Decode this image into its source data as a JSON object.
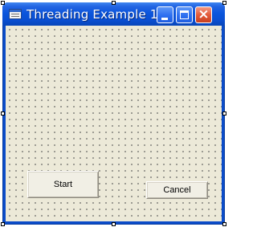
{
  "window": {
    "title": "Threading Example 1",
    "title_buttons": {
      "minimize_icon": "minimize-icon",
      "maximize_icon": "maximize-icon",
      "close_icon": "close-icon"
    }
  },
  "form": {
    "buttons": {
      "start_label": "Start",
      "cancel_label": "Cancel"
    }
  },
  "colors": {
    "titlebar_blue": "#0b56dd",
    "close_red": "#e35b3b",
    "client_bg": "#ece9d8",
    "grid_dot": "#555555"
  }
}
